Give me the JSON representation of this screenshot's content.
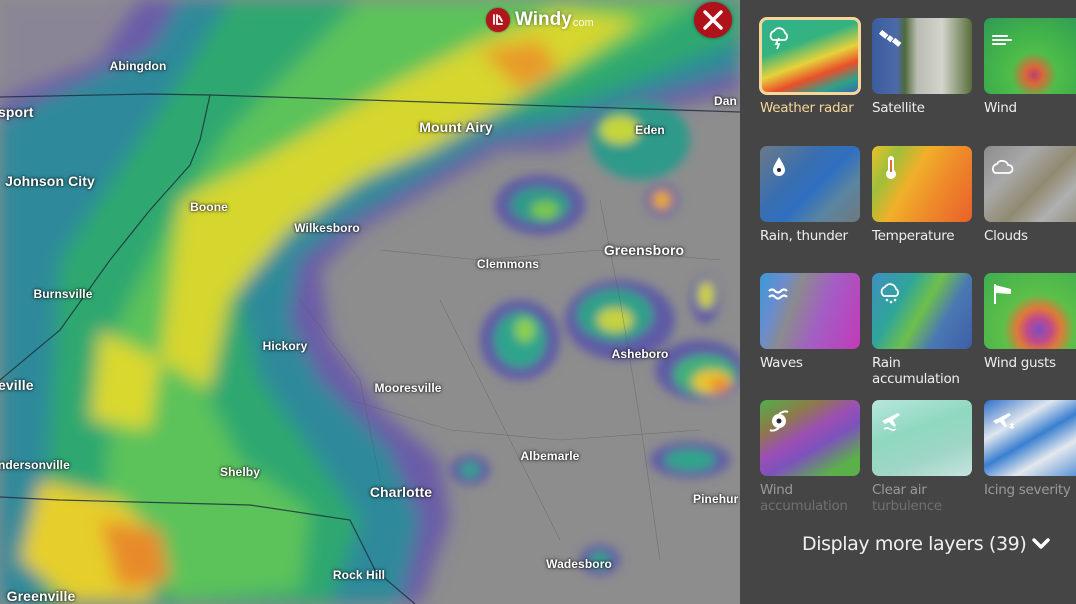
{
  "app": {
    "brand": "Windy",
    "brand_suffix": "com",
    "close_label": "Close"
  },
  "map": {
    "layer": "Weather radar",
    "cities": [
      {
        "name": "Abingdon",
        "size": "small"
      },
      {
        "name": "sport",
        "size": "big"
      },
      {
        "name": "Johnson City",
        "size": "big"
      },
      {
        "name": "Boone",
        "size": "small"
      },
      {
        "name": "Mount Airy",
        "size": "big"
      },
      {
        "name": "Eden",
        "size": "small"
      },
      {
        "name": "Dan",
        "size": "small"
      },
      {
        "name": "Wilkesboro",
        "size": "small"
      },
      {
        "name": "Clemmons",
        "size": "small"
      },
      {
        "name": "Greensboro",
        "size": "big"
      },
      {
        "name": "Burnsville",
        "size": "small"
      },
      {
        "name": "Hickory",
        "size": "small"
      },
      {
        "name": "Asheboro",
        "size": "small"
      },
      {
        "name": "Mooresville",
        "size": "small"
      },
      {
        "name": "eville",
        "size": "big"
      },
      {
        "name": "Albemarle",
        "size": "small"
      },
      {
        "name": "ndersonville",
        "size": "small"
      },
      {
        "name": "Shelby",
        "size": "small"
      },
      {
        "name": "Charlotte",
        "size": "big"
      },
      {
        "name": "Pinehur",
        "size": "small"
      },
      {
        "name": "Rock Hill",
        "size": "small"
      },
      {
        "name": "Wadesboro",
        "size": "small"
      },
      {
        "name": "Greenville",
        "size": "big"
      }
    ]
  },
  "layers_panel": {
    "items": [
      {
        "label": "Weather radar",
        "label2": "",
        "icon": "radar-thunder-icon",
        "active": true
      },
      {
        "label": "Satellite",
        "label2": "",
        "icon": "satellite-icon",
        "active": false
      },
      {
        "label": "Wind",
        "label2": "",
        "icon": "wind-icon",
        "active": false
      },
      {
        "label": "Rain, thunder",
        "label2": "",
        "icon": "raindrop-icon",
        "active": false
      },
      {
        "label": "Temperature",
        "label2": "",
        "icon": "thermometer-icon",
        "active": false
      },
      {
        "label": "Clouds",
        "label2": "",
        "icon": "clouds-icon",
        "active": false
      },
      {
        "label": "Waves",
        "label2": "",
        "icon": "waves-icon",
        "active": false
      },
      {
        "label": "Rain",
        "label2": "accumulation",
        "icon": "rain-cloud-icon",
        "active": false
      },
      {
        "label": "Wind gusts",
        "label2": "",
        "icon": "windsock-icon",
        "active": false
      },
      {
        "label": "Wind",
        "label2": "accumulation",
        "icon": "hurricane-icon",
        "active": false
      },
      {
        "label": "Clear air",
        "label2": "turbulence",
        "icon": "plane-turbulence-icon",
        "active": false
      },
      {
        "label": "Icing severity",
        "label2": "",
        "icon": "plane-icing-icon",
        "active": false
      }
    ],
    "more_button": {
      "label": "Display more layers (39)",
      "count": 39
    },
    "colors": {
      "active_accent": "#f5d79a",
      "panel_bg": "#454545",
      "close_red": "#b0121b"
    }
  }
}
